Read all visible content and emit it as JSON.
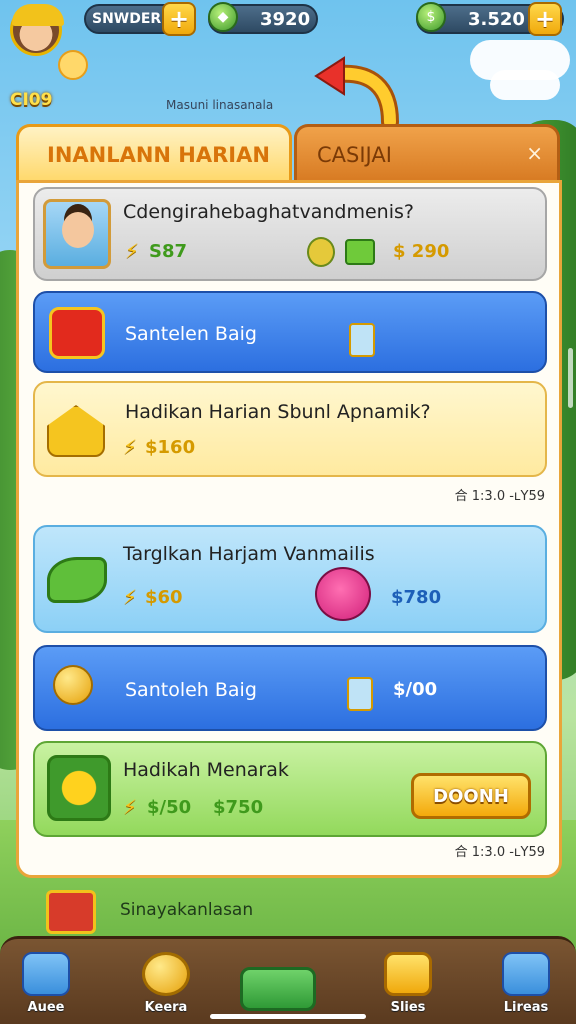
{
  "hud": {
    "player_name": "SNWDER",
    "level": "CI09",
    "gems": "3920",
    "coins": "3.520",
    "plus": "+"
  },
  "subtitle": "Masuni linasanala",
  "tabs": {
    "daily": "INANLANN HARIAN",
    "casual": "CASIJAI",
    "close": "×"
  },
  "cards": [
    {
      "title": "Cdengirahebaghatvandmenis?",
      "reward_a": "S87",
      "reward_b": "$ 290"
    },
    {
      "title": "Santelen Baig"
    },
    {
      "title": "Hadikan Harian Sbunl Apnamik?",
      "reward_a": "$160"
    },
    {
      "title": "Targlkan Harjam Vanmailis",
      "reward_a": "$60",
      "reward_b": "$780"
    },
    {
      "title": "Santoleh Baig",
      "reward_b": "$/00"
    },
    {
      "title": "Hadikah Menarak",
      "reward_a": "$/50",
      "reward_b": "$750",
      "button": "DOONH"
    }
  ],
  "timers": [
    "合 1:3.0 -ʟY59",
    "合 1:3.0 -ʟY59"
  ],
  "footer_note": "Sinayakanlasan",
  "nav": [
    {
      "label": "Auee",
      "icon": "home-icon"
    },
    {
      "label": "Keera",
      "icon": "coin-icon"
    },
    {
      "label": "",
      "icon": "tasks-icon"
    },
    {
      "label": "Slies",
      "icon": "shop-icon"
    },
    {
      "label": "Lireas",
      "icon": "items-icon"
    }
  ],
  "colors": {
    "tab_active": "#ffd86a",
    "tab_inactive": "#d77a22",
    "card_blue": "#2c6fe0",
    "card_green": "#93d95c",
    "gold": "#f3a90b"
  }
}
